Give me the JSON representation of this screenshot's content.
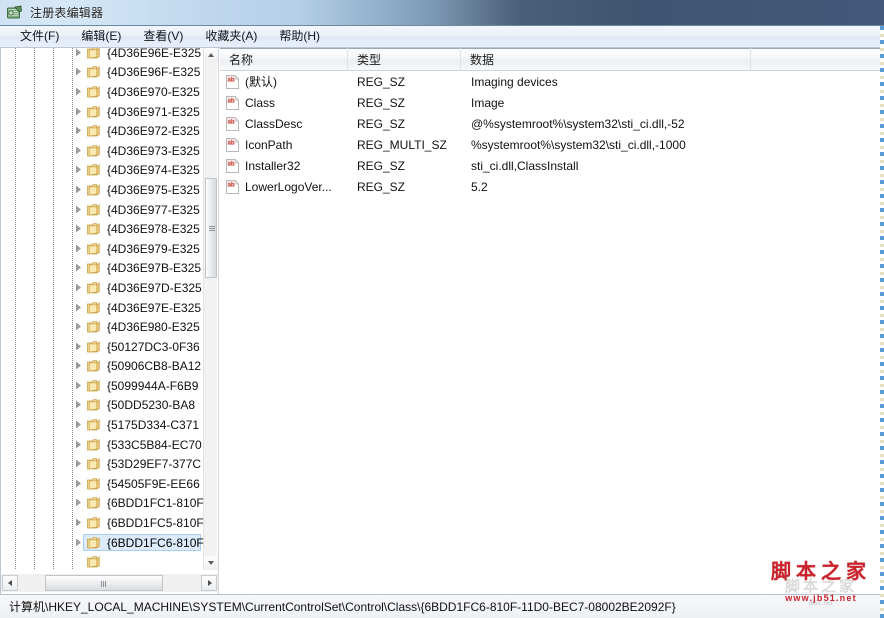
{
  "window": {
    "title": "注册表编辑器",
    "icon": "registry-editor-icon"
  },
  "menu": {
    "items": [
      {
        "label": "文件(F)",
        "name": "menu-file"
      },
      {
        "label": "编辑(E)",
        "name": "menu-edit"
      },
      {
        "label": "查看(V)",
        "name": "menu-view"
      },
      {
        "label": "收藏夹(A)",
        "name": "menu-favorites"
      },
      {
        "label": "帮助(H)",
        "name": "menu-help"
      }
    ]
  },
  "tree": {
    "nodes": [
      {
        "label": "{4D36E96E-E325",
        "selected": false
      },
      {
        "label": "{4D36E96F-E325",
        "selected": false
      },
      {
        "label": "{4D36E970-E325",
        "selected": false
      },
      {
        "label": "{4D36E971-E325",
        "selected": false
      },
      {
        "label": "{4D36E972-E325",
        "selected": false
      },
      {
        "label": "{4D36E973-E325",
        "selected": false
      },
      {
        "label": "{4D36E974-E325",
        "selected": false
      },
      {
        "label": "{4D36E975-E325",
        "selected": false
      },
      {
        "label": "{4D36E977-E325",
        "selected": false
      },
      {
        "label": "{4D36E978-E325",
        "selected": false
      },
      {
        "label": "{4D36E979-E325",
        "selected": false
      },
      {
        "label": "{4D36E97B-E325",
        "selected": false
      },
      {
        "label": "{4D36E97D-E325",
        "selected": false
      },
      {
        "label": "{4D36E97E-E325",
        "selected": false
      },
      {
        "label": "{4D36E980-E325",
        "selected": false
      },
      {
        "label": "{50127DC3-0F36",
        "selected": false
      },
      {
        "label": "{50906CB8-BA12",
        "selected": false
      },
      {
        "label": "{5099944A-F6B9",
        "selected": false
      },
      {
        "label": "{50DD5230-BA8",
        "selected": false
      },
      {
        "label": "{5175D334-C371",
        "selected": false
      },
      {
        "label": "{533C5B84-EC70",
        "selected": false
      },
      {
        "label": "{53D29EF7-377C",
        "selected": false
      },
      {
        "label": "{54505F9E-EE66",
        "selected": false
      },
      {
        "label": "{6BDD1FC1-810F",
        "selected": false
      },
      {
        "label": "{6BDD1FC5-810F",
        "selected": false
      },
      {
        "label": "{6BDD1FC6-810F",
        "selected": true
      }
    ],
    "vertical_scrollbar": {
      "name": "tree-vertical-scrollbar"
    },
    "horizontal_scrollbar": {
      "name": "tree-horizontal-scrollbar"
    }
  },
  "list": {
    "columns": [
      {
        "label": "名称",
        "name": "column-header-name"
      },
      {
        "label": "类型",
        "name": "column-header-type"
      },
      {
        "label": "数据",
        "name": "column-header-data"
      }
    ],
    "rows": [
      {
        "name": "(默认)",
        "type": "REG_SZ",
        "data": "Imaging devices"
      },
      {
        "name": "Class",
        "type": "REG_SZ",
        "data": "Image"
      },
      {
        "name": "ClassDesc",
        "type": "REG_SZ",
        "data": "@%systemroot%\\system32\\sti_ci.dll,-52"
      },
      {
        "name": "IconPath",
        "type": "REG_MULTI_SZ",
        "data": "%systemroot%\\system32\\sti_ci.dll,-1000"
      },
      {
        "name": "Installer32",
        "type": "REG_SZ",
        "data": "sti_ci.dll,ClassInstall"
      },
      {
        "name": "LowerLogoVer...",
        "type": "REG_SZ",
        "data": "5.2"
      }
    ]
  },
  "statusbar": {
    "path": "计算机\\HKEY_LOCAL_MACHINE\\SYSTEM\\CurrentControlSet\\Control\\Class\\{6BDD1FC6-810F-11D0-BEC7-08002BE2092F}"
  },
  "watermark": {
    "main": "脚本之家",
    "ghost": "脚本之家",
    "url": "www.jb51.net",
    "sub": "jb51.net"
  },
  "colors": {
    "selection_fill": "#dcecfd",
    "selection_border": "#aacef0",
    "title_gradient_left": "#cfe2f3",
    "title_gradient_right": "#44597a",
    "watermark_red": "#c8232c"
  }
}
